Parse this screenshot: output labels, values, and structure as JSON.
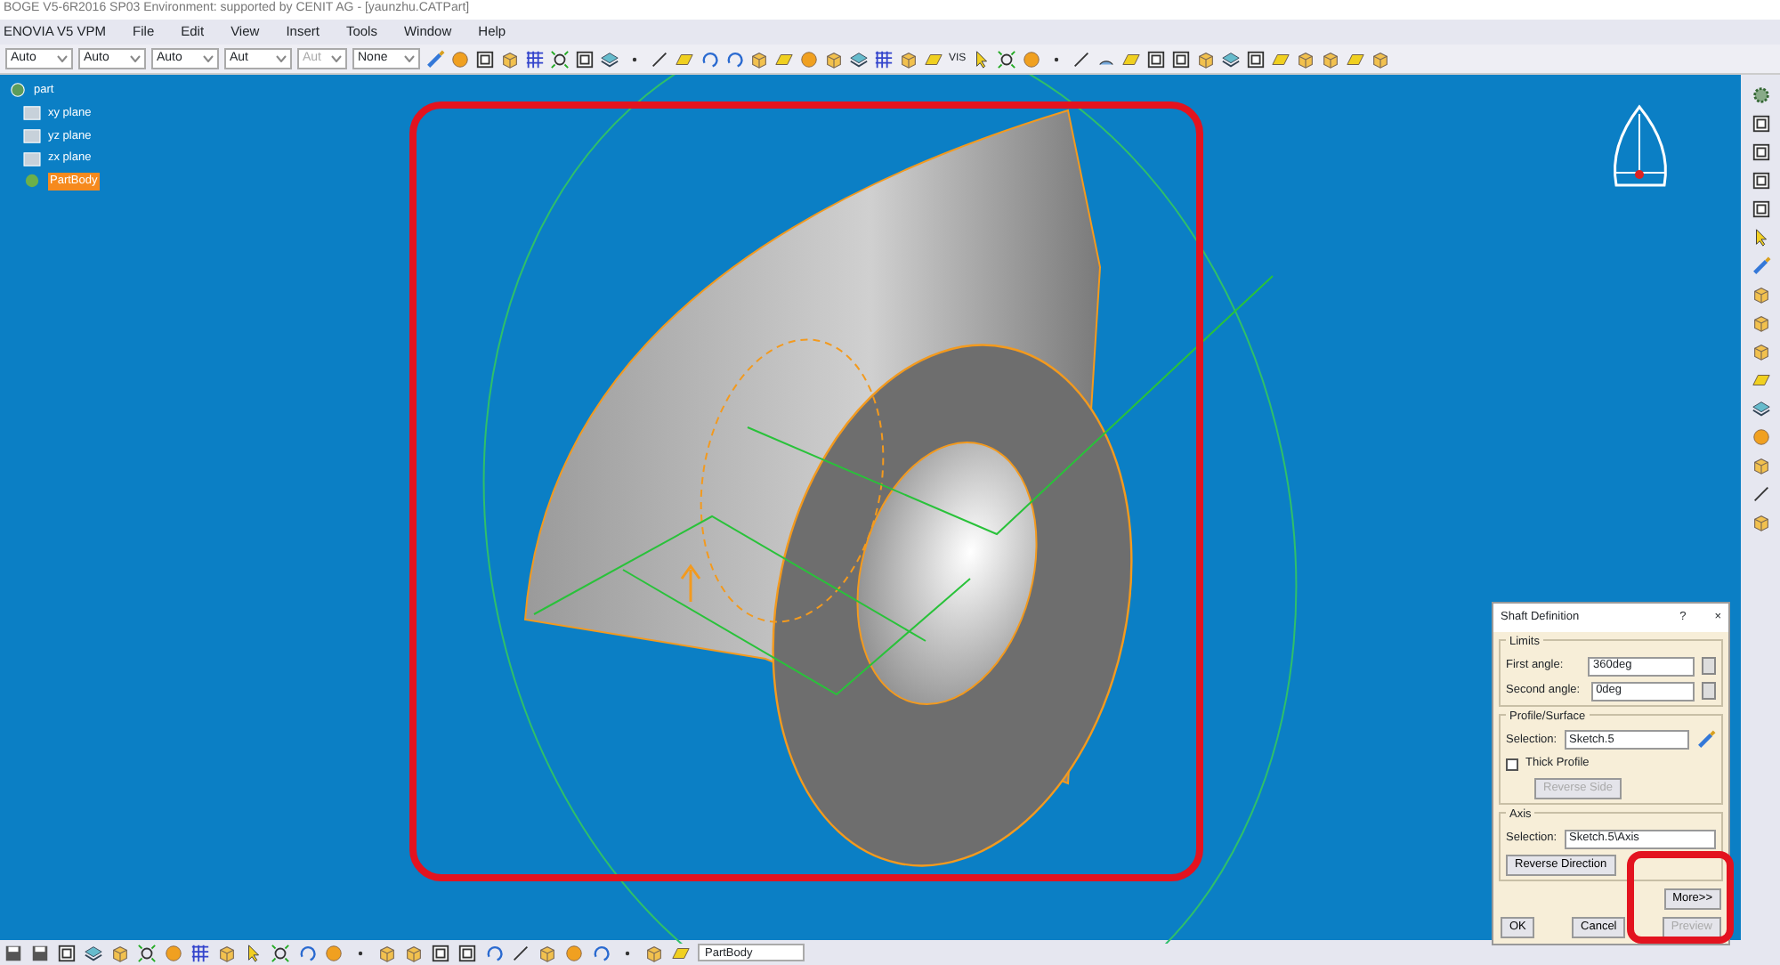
{
  "window": {
    "title": "BOGE V5-6R2016 SP03 Environment: supported by CENIT AG - [yaunzhu.CATPart]"
  },
  "menu": [
    {
      "label": "ENOVIA V5 VPM"
    },
    {
      "label": "File"
    },
    {
      "label": "Edit"
    },
    {
      "label": "View"
    },
    {
      "label": "Insert"
    },
    {
      "label": "Tools"
    },
    {
      "label": "Window"
    },
    {
      "label": "Help"
    }
  ],
  "toolbar": {
    "dropdowns": [
      {
        "value": "Auto",
        "disabled": false
      },
      {
        "value": "Auto",
        "disabled": false
      },
      {
        "value": "Auto",
        "disabled": false
      },
      {
        "value": "Aut",
        "disabled": false
      },
      {
        "value": "Aut",
        "disabled": true
      },
      {
        "value": "None",
        "disabled": false
      }
    ],
    "label": "VIS"
  },
  "tree": {
    "root": "part",
    "children": [
      {
        "label": "xy plane",
        "selected": false
      },
      {
        "label": "yz plane",
        "selected": false
      },
      {
        "label": "zx plane",
        "selected": false
      },
      {
        "label": "PartBody",
        "selected": true
      }
    ]
  },
  "dialog": {
    "title": "Shaft Definition",
    "help": "?",
    "close": "×",
    "limits": {
      "legend": "Limits",
      "fields": [
        {
          "label": "First angle:",
          "value": "360deg"
        },
        {
          "label": "Second angle:",
          "value": "0deg"
        }
      ]
    },
    "profile": {
      "legend": "Profile/Surface",
      "selection_label": "Selection:",
      "selection": "Sketch.5",
      "thick_profile": {
        "label": "Thick Profile",
        "checked": false
      },
      "reverse_side": {
        "label": "Reverse Side",
        "disabled": true
      }
    },
    "axis": {
      "legend": "Axis",
      "selection_label": "Selection:",
      "selection": "Sketch.5\\Axis",
      "reverse": "Reverse Direction"
    },
    "more": "More>>",
    "buttons": [
      {
        "label": "OK",
        "disabled": false
      },
      {
        "label": "Cancel",
        "disabled": false
      },
      {
        "label": "Preview",
        "disabled": true
      }
    ]
  },
  "status_bar": {
    "field": "PartBody"
  }
}
